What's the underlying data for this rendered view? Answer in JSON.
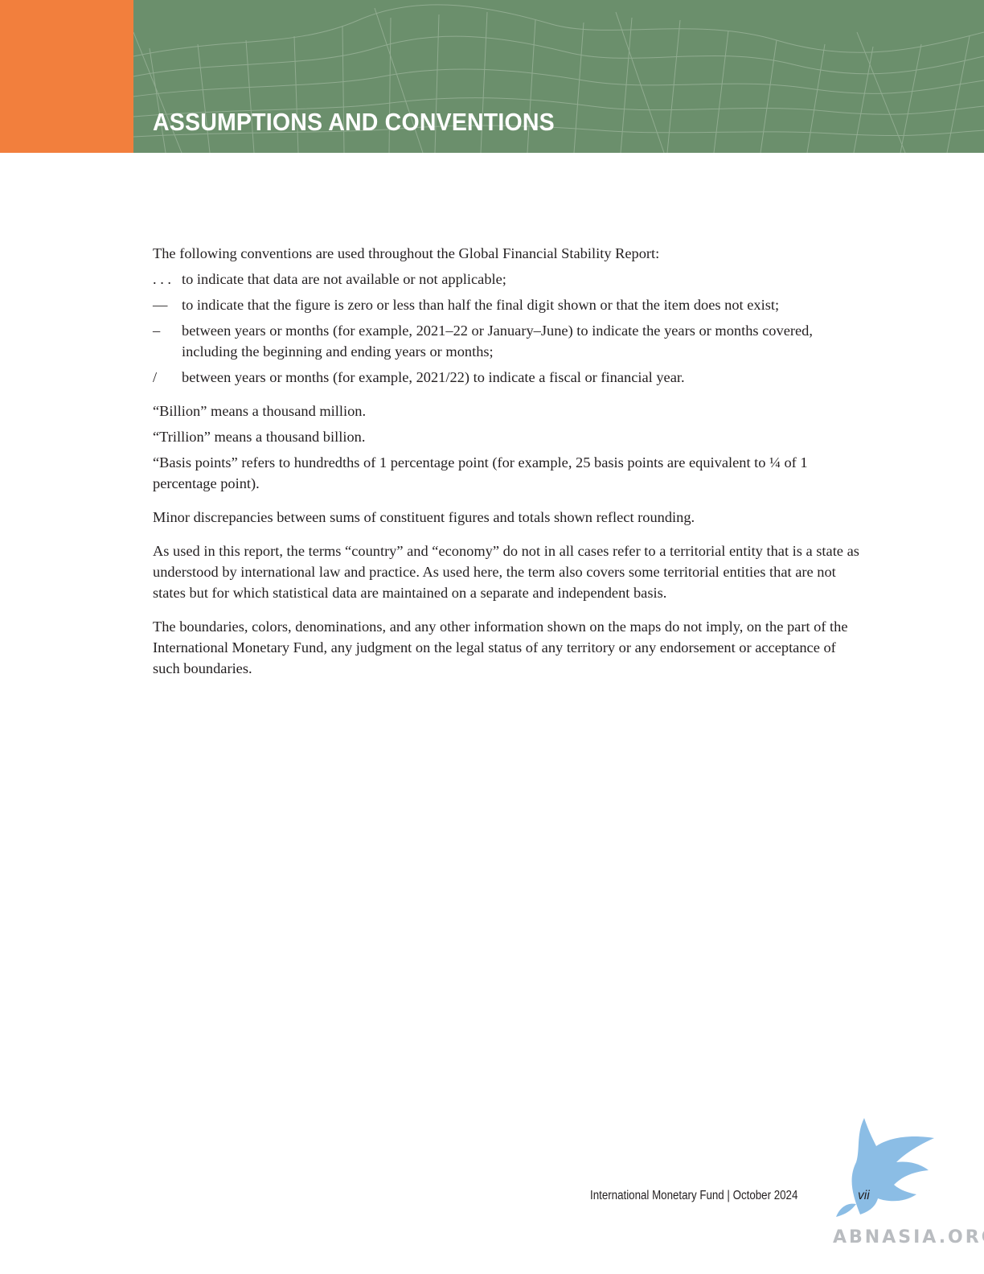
{
  "header": {
    "title": "ASSUMPTIONS AND CONVENTIONS",
    "colors": {
      "accent_orange": "#f27f3d",
      "band_green": "#6b8f6c",
      "wire_green": "#9db59c"
    }
  },
  "intro": "The following conventions are used throughout the Global Financial Stability Report:",
  "conventions": [
    {
      "symbol": ". . .",
      "text": "to indicate that data are not available or not applicable;"
    },
    {
      "symbol": "—",
      "text": "to indicate that the figure is zero or less than half the final digit shown or that the item does not exist;"
    },
    {
      "symbol": "–",
      "text": "between years or months (for example, 2021–22 or January–June) to indicate the years or months covered, including the beginning and ending years or months;"
    },
    {
      "symbol": "/",
      "text": "between years or months (for example, 2021/22) to indicate a fiscal or financial year."
    }
  ],
  "definitions": [
    "“Billion” means a thousand million.",
    "“Trillion” means a thousand billion.",
    "“Basis points” refers to hundredths of 1 percentage point (for example, 25 basis points are equivalent to ¼ of 1 percentage point)."
  ],
  "rounding_note": "Minor discrepancies between sums of constituent figures and totals shown reflect rounding.",
  "country_note": "As used in this report, the terms “country” and “economy” do not in all cases refer to a territorial entity that is a state as understood by international law and practice. As used here, the term also covers some territorial entities that are not states but for which statistical data are maintained on a separate and independent basis.",
  "boundaries_note": "The boundaries, colors, denominations, and any other information shown on the maps do not imply, on the part of the International Monetary Fund, any judgment on the legal status of any territory or any endorsement or acceptance of such boundaries.",
  "footer": {
    "publisher": "International Monetary Fund | October 2024",
    "page_number": "vii"
  },
  "watermark": {
    "text": "ABNASIA.ORG",
    "icon": "griffin-logo-icon",
    "color": "#7fb6e3"
  }
}
